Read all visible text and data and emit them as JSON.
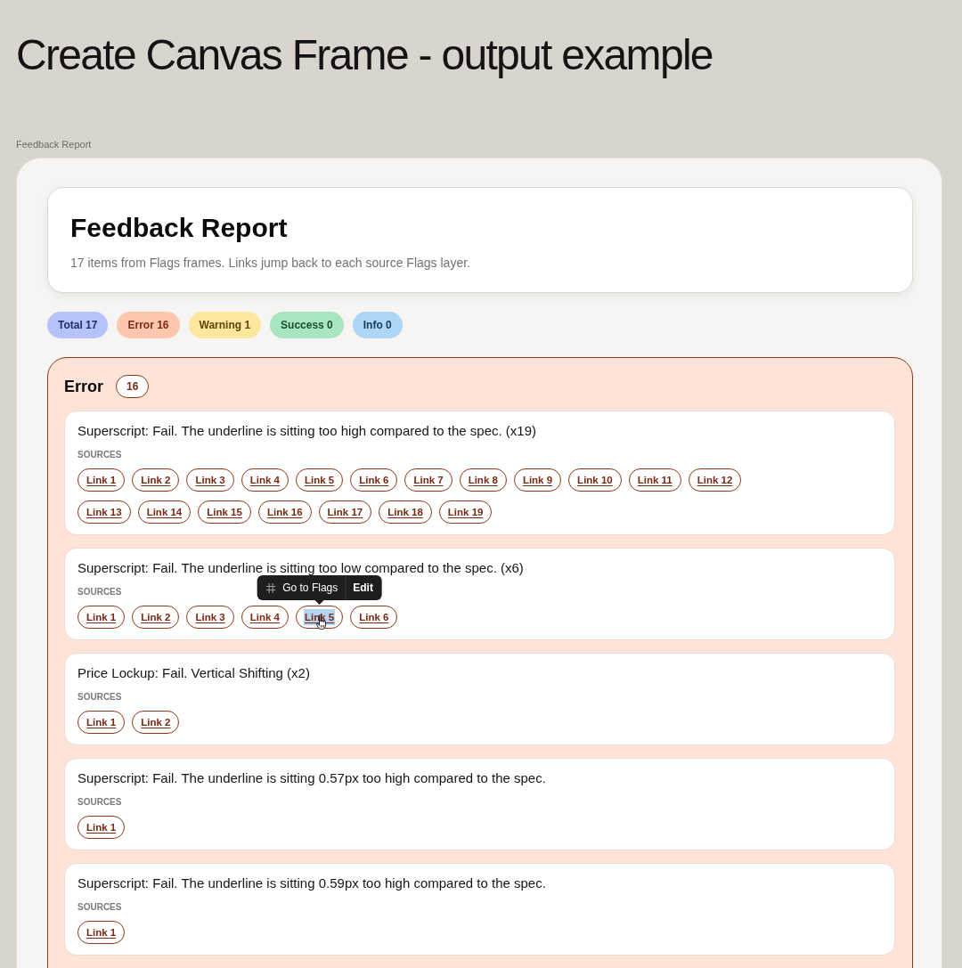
{
  "page_title": "Create Canvas Frame - output example",
  "frame_label": "Feedback Report",
  "report": {
    "title": "Feedback Report",
    "subtitle": "17 items from Flags frames. Links jump back to each source Flags layer."
  },
  "stats": [
    {
      "kind": "total",
      "label": "Total 17"
    },
    {
      "kind": "error",
      "label": "Error 16"
    },
    {
      "kind": "warning",
      "label": "Warning 1"
    },
    {
      "kind": "success",
      "label": "Success 0"
    },
    {
      "kind": "info",
      "label": "Info 0"
    }
  ],
  "sections": [
    {
      "kind": "error",
      "title": "Error",
      "count": "16",
      "items": [
        {
          "text": "Superscript: Fail. The underline is sitting too high compared to the spec. (x19)",
          "sources_label": "SOURCES",
          "links": [
            {
              "label": "Link 1",
              "selected": false
            },
            {
              "label": "Link 2",
              "selected": false
            },
            {
              "label": "Link 3",
              "selected": false
            },
            {
              "label": "Link 4",
              "selected": false
            },
            {
              "label": "Link 5",
              "selected": false
            },
            {
              "label": "Link 6",
              "selected": false
            },
            {
              "label": "Link 7",
              "selected": false
            },
            {
              "label": "Link 8",
              "selected": false
            },
            {
              "label": "Link 9",
              "selected": false
            },
            {
              "label": "Link 10",
              "selected": false
            },
            {
              "label": "Link 11",
              "selected": false
            },
            {
              "label": "Link 12",
              "selected": false
            },
            {
              "label": "Link 13",
              "selected": false
            },
            {
              "label": "Link 14",
              "selected": false
            },
            {
              "label": "Link 15",
              "selected": false
            },
            {
              "label": "Link 16",
              "selected": false
            },
            {
              "label": "Link 17",
              "selected": false
            },
            {
              "label": "Link 18",
              "selected": false
            },
            {
              "label": "Link 19",
              "selected": false
            }
          ]
        },
        {
          "text": "Superscript: Fail. The underline is sitting too low compared to the spec. (x6)",
          "sources_label": "SOURCES",
          "links": [
            {
              "label": "Link 1",
              "selected": false
            },
            {
              "label": "Link 2",
              "selected": false
            },
            {
              "label": "Link 3",
              "selected": false
            },
            {
              "label": "Link 4",
              "selected": false
            },
            {
              "label": "Link 5",
              "selected": true
            },
            {
              "label": "Link 6",
              "selected": false
            }
          ],
          "tooltip": {
            "actions": [
              {
                "kind": "goto",
                "label": "Go to Flags"
              },
              {
                "kind": "edit",
                "label": "Edit"
              }
            ]
          }
        },
        {
          "text": "Price Lockup: Fail. Vertical Shifting (x2)",
          "sources_label": "SOURCES",
          "links": [
            {
              "label": "Link 1",
              "selected": false
            },
            {
              "label": "Link 2",
              "selected": false
            }
          ]
        },
        {
          "text": "Superscript: Fail. The underline is sitting 0.57px too high compared to the spec.",
          "sources_label": "SOURCES",
          "links": [
            {
              "label": "Link 1",
              "selected": false
            }
          ]
        },
        {
          "text": "Superscript: Fail. The underline is sitting 0.59px too high compared to the spec.",
          "sources_label": "SOURCES",
          "links": [
            {
              "label": "Link 1",
              "selected": false
            }
          ]
        }
      ]
    }
  ]
}
